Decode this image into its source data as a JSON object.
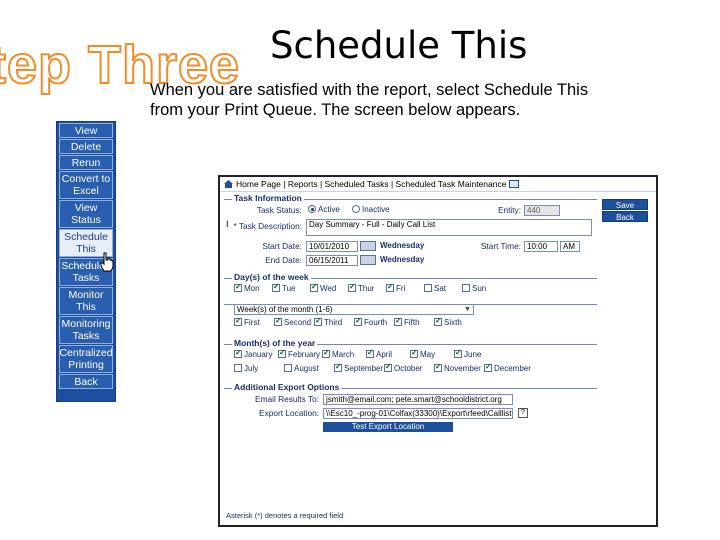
{
  "step_title": "tep Three",
  "slide_title": "Schedule This",
  "instructions": "When you are satisfied with the report, select Schedule This from your Print Queue.  The screen below appears.",
  "nav": {
    "items": [
      {
        "label": "View",
        "tall": false,
        "active": false
      },
      {
        "label": "Delete",
        "tall": false,
        "active": false
      },
      {
        "label": "Rerun",
        "tall": false,
        "active": false
      },
      {
        "label": "Convert to Excel",
        "tall": true,
        "active": false
      },
      {
        "label": "View Status",
        "tall": true,
        "active": false
      },
      {
        "label": "Schedule This",
        "tall": true,
        "active": true
      },
      {
        "label": "Scheduled Tasks",
        "tall": true,
        "active": false
      },
      {
        "label": "Monitor This",
        "tall": true,
        "active": false
      },
      {
        "label": "Monitoring Tasks",
        "tall": true,
        "active": false
      },
      {
        "label": "Centralized Printing",
        "tall": true,
        "active": false
      },
      {
        "label": "Back",
        "tall": false,
        "active": false
      }
    ]
  },
  "breadcrumb": "Home Page | Reports | Scheduled Tasks | Scheduled Task Maintenance",
  "side_buttons": {
    "save": "Save",
    "back": "Back"
  },
  "task_info": {
    "heading": "Task Information",
    "status_label": "Task Status:",
    "active": "Active",
    "inactive": "Inactive",
    "entity_label": "Entity:",
    "entity_value": "440",
    "desc_label": "* Task Description:",
    "desc_value": "Day Summary - Full - Daily Call List",
    "start_date_label": "Start Date:",
    "start_date_value": "10/01/2010",
    "start_day": "Wednesday",
    "start_time_label": "Start Time:",
    "start_time_value": "10:00",
    "start_time_ampm": "AM",
    "end_date_label": "End Date:",
    "end_date_value": "06/15/2011",
    "end_day": "Wednesday"
  },
  "days": {
    "heading": "Day(s) of the week",
    "items": [
      {
        "label": "Mon",
        "checked": true
      },
      {
        "label": "Tue",
        "checked": true
      },
      {
        "label": "Wed",
        "checked": true
      },
      {
        "label": "Thur",
        "checked": true
      },
      {
        "label": "Fri",
        "checked": true
      },
      {
        "label": "Sat",
        "checked": false
      },
      {
        "label": "Sun",
        "checked": false
      }
    ]
  },
  "weeks": {
    "select_value": "Week(s) of the month  (1-6)",
    "items": [
      {
        "label": "First",
        "checked": true
      },
      {
        "label": "Second",
        "checked": true
      },
      {
        "label": "Third",
        "checked": true
      },
      {
        "label": "Fourth",
        "checked": true
      },
      {
        "label": "Fifth",
        "checked": true
      },
      {
        "label": "Sixth",
        "checked": true
      }
    ]
  },
  "months": {
    "heading": "Month(s) of the year",
    "items": [
      {
        "label": "January",
        "checked": true
      },
      {
        "label": "February",
        "checked": true
      },
      {
        "label": "March",
        "checked": true
      },
      {
        "label": "April",
        "checked": true
      },
      {
        "label": "May",
        "checked": true
      },
      {
        "label": "June",
        "checked": true
      },
      {
        "label": "July",
        "checked": false
      },
      {
        "label": "August",
        "checked": false
      },
      {
        "label": "September",
        "checked": true
      },
      {
        "label": "October",
        "checked": true
      },
      {
        "label": "November",
        "checked": true
      },
      {
        "label": "December",
        "checked": true
      }
    ]
  },
  "export": {
    "heading": "Additional Export Options",
    "email_label": "Email Results To:",
    "email_value": "jsmith@email.com; pete.smart@schooldistrict.org",
    "location_label": "Export Location:",
    "location_value": "\\\\Esc10_-prog-01\\Colfax(33300)\\Export\\rfeed\\Calllist.pdf",
    "test_button": "Test Export Location"
  },
  "footnote": "Asterisk (*) denotes a required field"
}
